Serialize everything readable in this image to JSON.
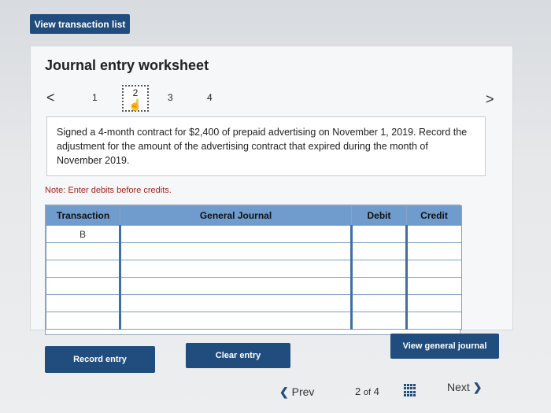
{
  "top_button": {
    "label": "View transaction list"
  },
  "worksheet": {
    "title": "Journal entry worksheet",
    "pager": {
      "prev_symbol": "<",
      "next_symbol": ">",
      "pages": [
        "1",
        "2",
        "3",
        "4"
      ],
      "current": "2"
    },
    "prompt": "Signed a 4-month contract for $2,400 of prepaid advertising on November 1, 2019. Record the adjustment for the amount of the advertising contract that expired during the month of November 2019.",
    "note_label": "Note:",
    "note_text": "Enter debits before credits."
  },
  "journal": {
    "headers": [
      "Transaction",
      "General Journal",
      "Debit",
      "Credit"
    ],
    "rows": [
      [
        "B",
        "",
        "",
        ""
      ],
      [
        "",
        "",
        "",
        ""
      ],
      [
        "",
        "",
        "",
        ""
      ],
      [
        "",
        "",
        "",
        ""
      ],
      [
        "",
        "",
        "",
        ""
      ],
      [
        "",
        "",
        "",
        ""
      ]
    ]
  },
  "buttons": {
    "record": "Record entry",
    "clear": "Clear entry",
    "view_general_journal": "View general journal"
  },
  "bottom_nav": {
    "prev_label": "Prev",
    "page_current": "2",
    "page_of": "of",
    "page_total": "4",
    "next_label": "Next"
  },
  "colors": {
    "primary_button": "#214d7e",
    "table_header": "#6f9ccc"
  }
}
